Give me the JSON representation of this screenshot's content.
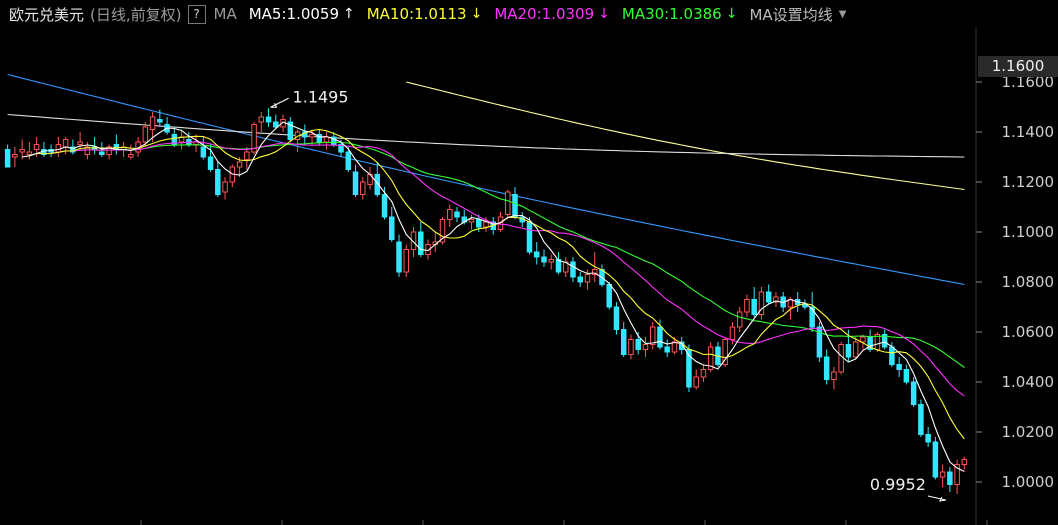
{
  "header": {
    "title": "欧元兑美元",
    "subtitle": "(日线,前复权)",
    "help_label": "?",
    "ma_label": "MA",
    "ma_settings_label": "MA设置均线",
    "ma_values": [
      {
        "label": "MA5:1.0059",
        "arrow": "↑",
        "color": "#ffffff"
      },
      {
        "label": "MA10:1.0113",
        "arrow": "↓",
        "color": "#ffff33"
      },
      {
        "label": "MA20:1.0309",
        "arrow": "↓",
        "color": "#ff33ff"
      },
      {
        "label": "MA30:1.0386",
        "arrow": "↓",
        "color": "#33ff33"
      }
    ]
  },
  "current_price_label": "1.1600",
  "chart_data": {
    "type": "candlestick",
    "title": "欧元兑美元",
    "y_ticks": [
      "1.1600",
      "1.1400",
      "1.1200",
      "1.1000",
      "1.0800",
      "1.0600",
      "1.0400",
      "1.0200",
      "1.0000"
    ],
    "ylim": [
      0.993,
      1.168
    ],
    "colors": {
      "up": "#ff5555",
      "down": "#33e6ff",
      "ma5": "#ffffff",
      "ma10": "#ffff33",
      "ma20": "#ff33ff",
      "ma30": "#33ff33",
      "ma60": "#dddddd",
      "ma120": "#3399ff",
      "ma250": "#ffff99"
    },
    "candles": [
      [
        1.133,
        1.135,
        1.126,
        1.126
      ],
      [
        1.13,
        1.134,
        1.126,
        1.131
      ],
      [
        1.132,
        1.137,
        1.129,
        1.133
      ],
      [
        1.131,
        1.136,
        1.129,
        1.132
      ],
      [
        1.133,
        1.138,
        1.13,
        1.135
      ],
      [
        1.133,
        1.136,
        1.13,
        1.131
      ],
      [
        1.133,
        1.135,
        1.13,
        1.132
      ],
      [
        1.132,
        1.138,
        1.13,
        1.135
      ],
      [
        1.134,
        1.138,
        1.131,
        1.137
      ],
      [
        1.134,
        1.137,
        1.131,
        1.132
      ],
      [
        1.135,
        1.14,
        1.133,
        1.136
      ],
      [
        1.131,
        1.136,
        1.129,
        1.134
      ],
      [
        1.134,
        1.138,
        1.131,
        1.133
      ],
      [
        1.132,
        1.136,
        1.13,
        1.131
      ],
      [
        1.131,
        1.135,
        1.129,
        1.134
      ],
      [
        1.135,
        1.139,
        1.131,
        1.133
      ],
      [
        1.133,
        1.136,
        1.13,
        1.134
      ],
      [
        1.13,
        1.135,
        1.129,
        1.131
      ],
      [
        1.132,
        1.138,
        1.13,
        1.136
      ],
      [
        1.136,
        1.144,
        1.134,
        1.142
      ],
      [
        1.141,
        1.148,
        1.136,
        1.146
      ],
      [
        1.145,
        1.149,
        1.142,
        1.144
      ],
      [
        1.143,
        1.146,
        1.139,
        1.14
      ],
      [
        1.139,
        1.142,
        1.134,
        1.135
      ],
      [
        1.136,
        1.141,
        1.133,
        1.138
      ],
      [
        1.137,
        1.14,
        1.134,
        1.135
      ],
      [
        1.135,
        1.139,
        1.132,
        1.136
      ],
      [
        1.134,
        1.138,
        1.129,
        1.13
      ],
      [
        1.13,
        1.135,
        1.124,
        1.125
      ],
      [
        1.125,
        1.128,
        1.114,
        1.115
      ],
      [
        1.116,
        1.122,
        1.113,
        1.12
      ],
      [
        1.12,
        1.127,
        1.118,
        1.126
      ],
      [
        1.126,
        1.13,
        1.122,
        1.128
      ],
      [
        1.129,
        1.134,
        1.125,
        1.132
      ],
      [
        1.132,
        1.144,
        1.131,
        1.143
      ],
      [
        1.144,
        1.148,
        1.14,
        1.146
      ],
      [
        1.146,
        1.1495,
        1.142,
        1.144
      ],
      [
        1.144,
        1.147,
        1.141,
        1.142
      ],
      [
        1.142,
        1.147,
        1.14,
        1.145
      ],
      [
        1.144,
        1.146,
        1.136,
        1.137
      ],
      [
        1.137,
        1.141,
        1.132,
        1.14
      ],
      [
        1.14,
        1.143,
        1.135,
        1.138
      ],
      [
        1.138,
        1.141,
        1.135,
        1.139
      ],
      [
        1.139,
        1.141,
        1.135,
        1.136
      ],
      [
        1.136,
        1.14,
        1.133,
        1.138
      ],
      [
        1.138,
        1.14,
        1.134,
        1.135
      ],
      [
        1.135,
        1.137,
        1.13,
        1.132
      ],
      [
        1.132,
        1.134,
        1.124,
        1.125
      ],
      [
        1.124,
        1.127,
        1.114,
        1.115
      ],
      [
        1.115,
        1.122,
        1.113,
        1.12
      ],
      [
        1.119,
        1.126,
        1.117,
        1.123
      ],
      [
        1.123,
        1.128,
        1.114,
        1.115
      ],
      [
        1.115,
        1.118,
        1.105,
        1.106
      ],
      [
        1.106,
        1.11,
        1.096,
        1.097
      ],
      [
        1.096,
        1.099,
        1.082,
        1.084
      ],
      [
        1.084,
        1.095,
        1.082,
        1.093
      ],
      [
        1.093,
        1.102,
        1.09,
        1.1
      ],
      [
        1.1,
        1.104,
        1.09,
        1.091
      ],
      [
        1.091,
        1.097,
        1.089,
        1.095
      ],
      [
        1.095,
        1.1,
        1.092,
        1.096
      ],
      [
        1.096,
        1.106,
        1.095,
        1.105
      ],
      [
        1.105,
        1.111,
        1.102,
        1.109
      ],
      [
        1.108,
        1.11,
        1.104,
        1.106
      ],
      [
        1.106,
        1.109,
        1.103,
        1.104
      ],
      [
        1.104,
        1.107,
        1.101,
        1.105
      ],
      [
        1.105,
        1.107,
        1.1,
        1.102
      ],
      [
        1.102,
        1.106,
        1.1,
        1.104
      ],
      [
        1.104,
        1.106,
        1.099,
        1.101
      ],
      [
        1.101,
        1.108,
        1.1,
        1.106
      ],
      [
        1.107,
        1.117,
        1.105,
        1.116
      ],
      [
        1.115,
        1.118,
        1.105,
        1.106
      ],
      [
        1.106,
        1.108,
        1.102,
        1.104
      ],
      [
        1.104,
        1.106,
        1.091,
        1.092
      ],
      [
        1.092,
        1.096,
        1.087,
        1.09
      ],
      [
        1.09,
        1.093,
        1.086,
        1.088
      ],
      [
        1.088,
        1.091,
        1.085,
        1.089
      ],
      [
        1.089,
        1.092,
        1.083,
        1.084
      ],
      [
        1.084,
        1.09,
        1.082,
        1.088
      ],
      [
        1.088,
        1.09,
        1.08,
        1.082
      ],
      [
        1.082,
        1.084,
        1.078,
        1.08
      ],
      [
        1.08,
        1.085,
        1.077,
        1.083
      ],
      [
        1.083,
        1.092,
        1.08,
        1.085
      ],
      [
        1.085,
        1.087,
        1.078,
        1.079
      ],
      [
        1.079,
        1.08,
        1.069,
        1.07
      ],
      [
        1.07,
        1.072,
        1.059,
        1.061
      ],
      [
        1.061,
        1.064,
        1.05,
        1.051
      ],
      [
        1.051,
        1.059,
        1.049,
        1.057
      ],
      [
        1.057,
        1.06,
        1.051,
        1.053
      ],
      [
        1.053,
        1.058,
        1.05,
        1.055
      ],
      [
        1.055,
        1.064,
        1.053,
        1.062
      ],
      [
        1.062,
        1.065,
        1.053,
        1.054
      ],
      [
        1.054,
        1.057,
        1.05,
        1.052
      ],
      [
        1.052,
        1.058,
        1.051,
        1.056
      ],
      [
        1.056,
        1.058,
        1.051,
        1.053
      ],
      [
        1.053,
        1.055,
        1.036,
        1.038
      ],
      [
        1.038,
        1.045,
        1.037,
        1.042
      ],
      [
        1.042,
        1.047,
        1.04,
        1.045
      ],
      [
        1.045,
        1.056,
        1.044,
        1.054
      ],
      [
        1.054,
        1.056,
        1.046,
        1.047
      ],
      [
        1.047,
        1.058,
        1.046,
        1.057
      ],
      [
        1.057,
        1.064,
        1.055,
        1.062
      ],
      [
        1.062,
        1.07,
        1.06,
        1.068
      ],
      [
        1.068,
        1.075,
        1.066,
        1.073
      ],
      [
        1.073,
        1.078,
        1.066,
        1.067
      ],
      [
        1.067,
        1.078,
        1.065,
        1.076
      ],
      [
        1.076,
        1.079,
        1.071,
        1.072
      ],
      [
        1.072,
        1.076,
        1.07,
        1.074
      ],
      [
        1.074,
        1.076,
        1.068,
        1.07
      ],
      [
        1.07,
        1.074,
        1.065,
        1.073
      ],
      [
        1.073,
        1.076,
        1.068,
        1.071
      ],
      [
        1.071,
        1.073,
        1.069,
        1.07
      ],
      [
        1.07,
        1.076,
        1.06,
        1.062
      ],
      [
        1.062,
        1.064,
        1.048,
        1.05
      ],
      [
        1.05,
        1.053,
        1.039,
        1.041
      ],
      [
        1.041,
        1.046,
        1.037,
        1.044
      ],
      [
        1.044,
        1.056,
        1.043,
        1.055
      ],
      [
        1.055,
        1.061,
        1.048,
        1.05
      ],
      [
        1.05,
        1.058,
        1.049,
        1.056
      ],
      [
        1.056,
        1.059,
        1.053,
        1.058
      ],
      [
        1.058,
        1.061,
        1.052,
        1.053
      ],
      [
        1.053,
        1.06,
        1.052,
        1.059
      ],
      [
        1.059,
        1.061,
        1.053,
        1.054
      ],
      [
        1.054,
        1.056,
        1.046,
        1.047
      ],
      [
        1.047,
        1.05,
        1.042,
        1.045
      ],
      [
        1.045,
        1.047,
        1.039,
        1.04
      ],
      [
        1.04,
        1.042,
        1.03,
        1.031
      ],
      [
        1.031,
        1.033,
        1.018,
        1.019
      ],
      [
        1.019,
        1.022,
        1.014,
        1.016
      ],
      [
        1.016,
        1.018,
        1.001,
        1.002
      ],
      [
        1.002,
        1.007,
        0.998,
        1.004
      ],
      [
        1.004,
        1.006,
        0.996,
        0.999
      ],
      [
        0.999,
        1.009,
        0.9952,
        1.007
      ],
      [
        1.007,
        1.01,
        1.005,
        1.009
      ]
    ],
    "ma60_start": [
      1.147,
      1.13
    ],
    "ma120_start": [
      1.163,
      1.079
    ],
    "ma250_start": [
      1.16,
      1.117
    ],
    "annotations": [
      {
        "text": "1.1495",
        "candle": 36,
        "price": 1.1495
      },
      {
        "text": "0.9952",
        "candle": 130,
        "price": 0.9952
      }
    ]
  }
}
